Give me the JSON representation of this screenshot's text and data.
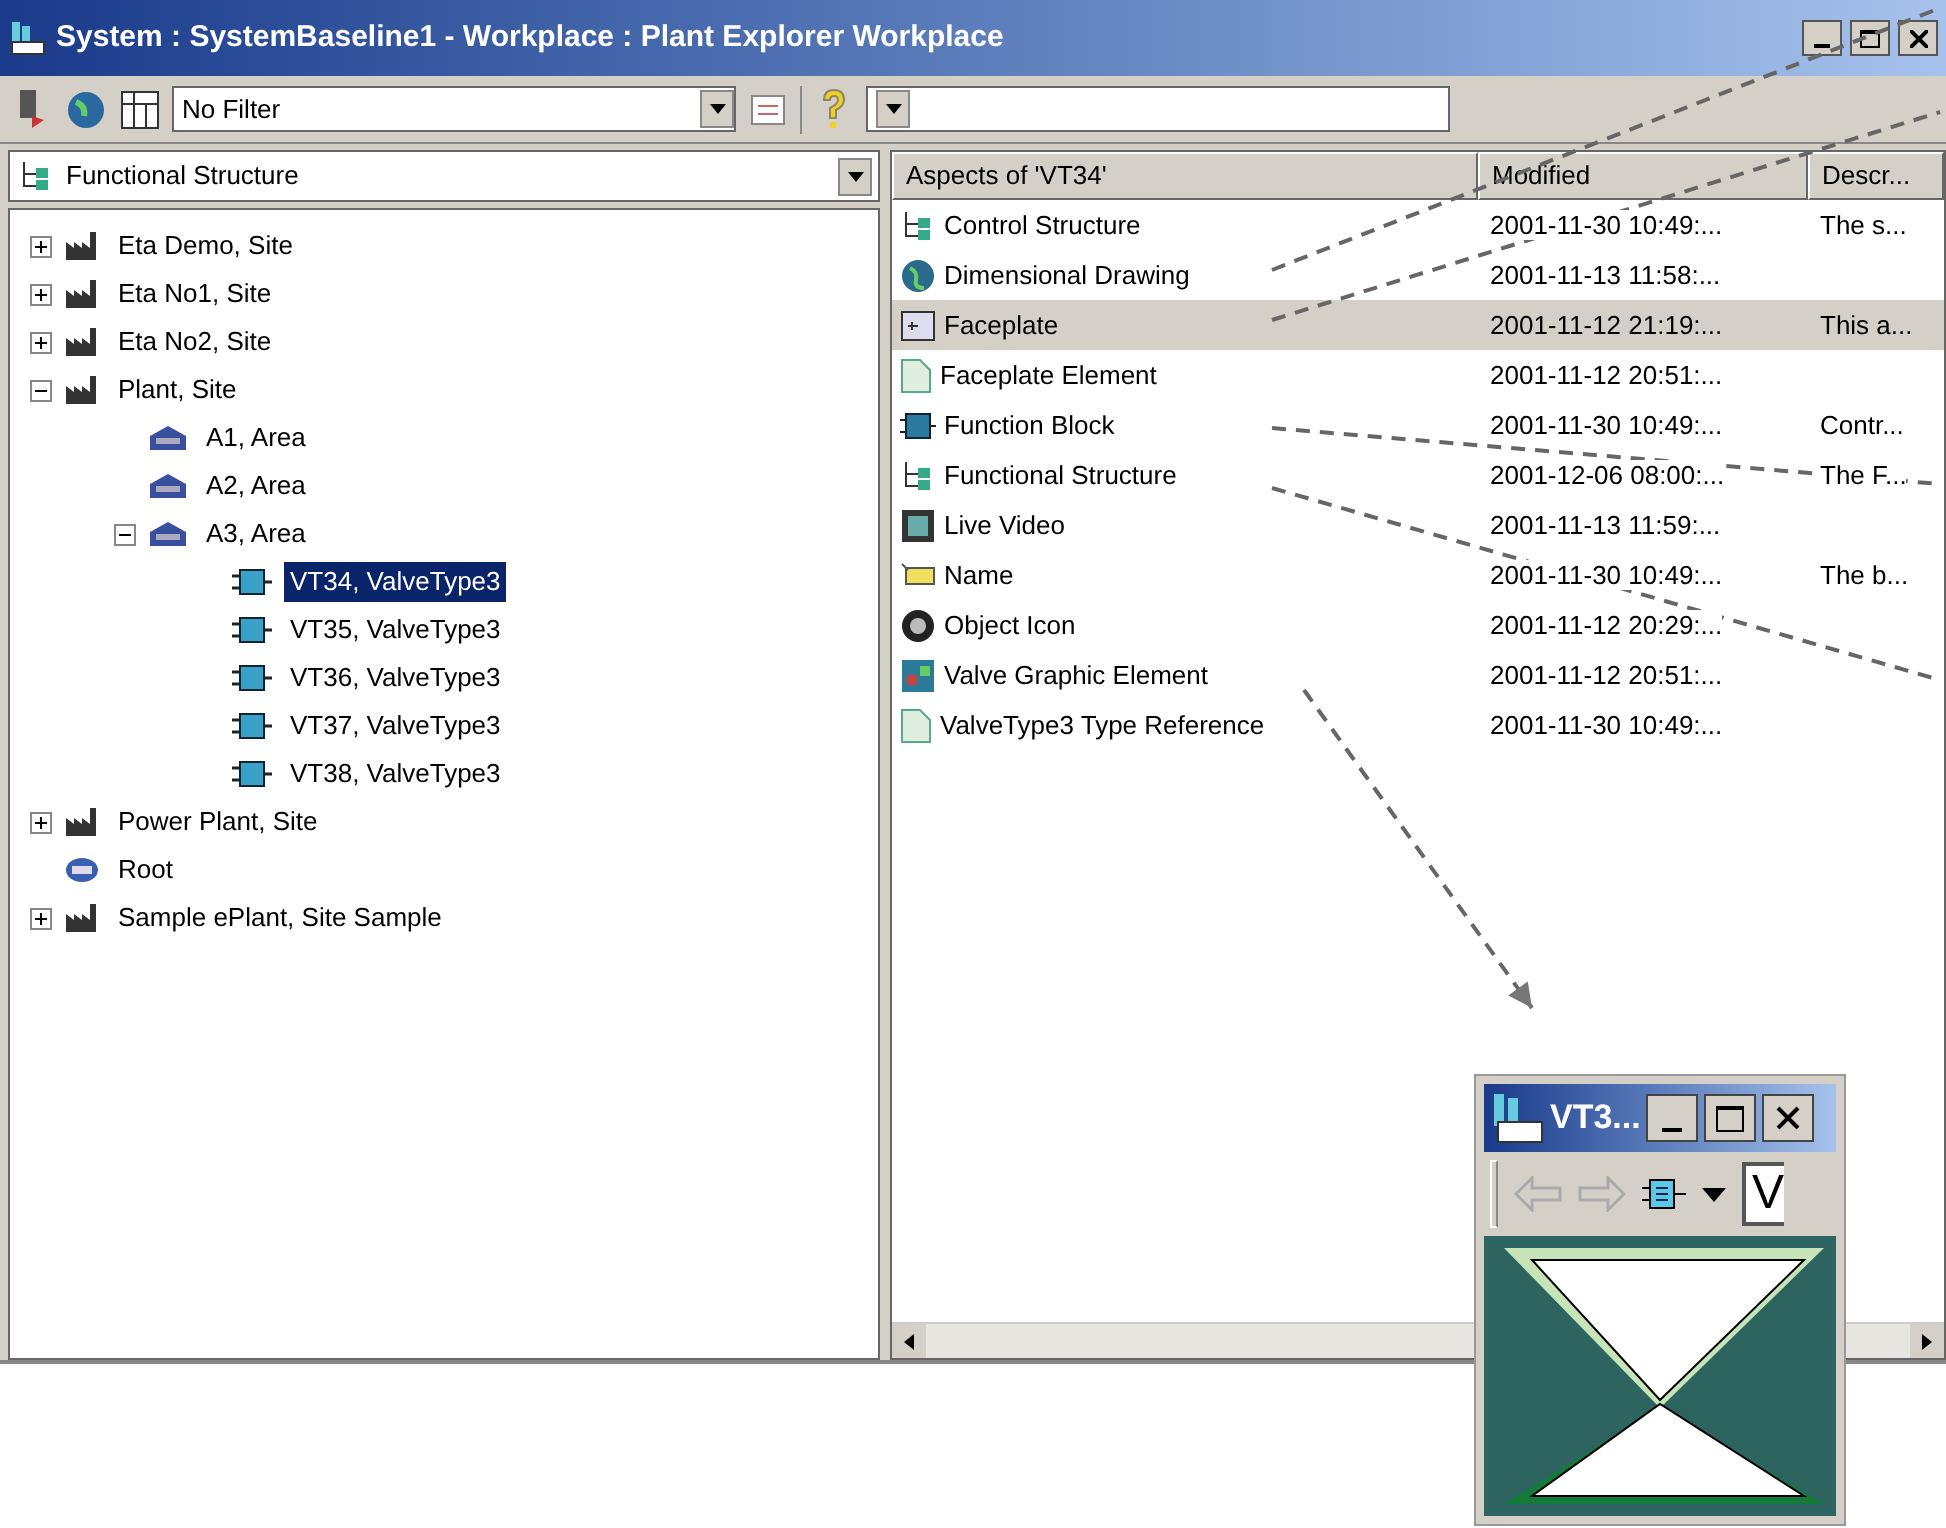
{
  "window": {
    "title": "System : SystemBaseline1 - Workplace : Plant Explorer Workplace"
  },
  "toolbar": {
    "filter": "No Filter"
  },
  "structure_selector": {
    "value": "Functional Structure"
  },
  "tree": [
    {
      "label": "Eta Demo, Site",
      "kind": "site",
      "expanded": false,
      "selected": false
    },
    {
      "label": "Eta No1, Site",
      "kind": "site",
      "expanded": false,
      "selected": false
    },
    {
      "label": "Eta No2, Site",
      "kind": "site",
      "expanded": false,
      "selected": false
    },
    {
      "label": "Plant, Site",
      "kind": "site",
      "expanded": true,
      "selected": false,
      "children": [
        {
          "label": "A1, Area",
          "kind": "area",
          "selected": false
        },
        {
          "label": "A2, Area",
          "kind": "area",
          "selected": false
        },
        {
          "label": "A3, Area",
          "kind": "area",
          "expanded": true,
          "selected": false,
          "children": [
            {
              "label": "VT34, ValveType3",
              "kind": "object",
              "selected": true
            },
            {
              "label": "VT35, ValveType3",
              "kind": "object",
              "selected": false
            },
            {
              "label": "VT36, ValveType3",
              "kind": "object",
              "selected": false
            },
            {
              "label": "VT37, ValveType3",
              "kind": "object",
              "selected": false
            },
            {
              "label": "VT38, ValveType3",
              "kind": "object",
              "selected": false
            }
          ]
        }
      ]
    },
    {
      "label": "Power Plant, Site",
      "kind": "site",
      "expanded": false,
      "selected": false
    },
    {
      "label": "Root",
      "kind": "root",
      "selected": false
    },
    {
      "label": "Sample ePlant, Site Sample",
      "kind": "site",
      "expanded": false,
      "selected": false
    }
  ],
  "aspects": {
    "columns": [
      "Aspects of 'VT34'",
      "Modified",
      "Descr..."
    ],
    "rows": [
      {
        "name": "Control Structure",
        "kind": "structure",
        "modified": "2001-11-30 10:49:...",
        "description": "The s...",
        "selected": false
      },
      {
        "name": "Dimensional Drawing",
        "kind": "globe",
        "modified": "2001-11-13 11:58:...",
        "selected": false
      },
      {
        "name": "Faceplate",
        "kind": "faceplate",
        "modified": "2001-11-12 21:19:...",
        "description": "This a...",
        "selected": true
      },
      {
        "name": "Faceplate Element",
        "kind": "document",
        "modified": "2001-11-12 20:51:...",
        "selected": false
      },
      {
        "name": "Function Block",
        "kind": "block",
        "modified": "2001-11-30 10:49:...",
        "description": "Contr...",
        "selected": false
      },
      {
        "name": "Functional Structure",
        "kind": "structure",
        "modified": "2001-12-06 08:00:...",
        "description": "The F...",
        "selected": false
      },
      {
        "name": "Live Video",
        "kind": "video",
        "modified": "2001-11-13 11:59:...",
        "selected": false
      },
      {
        "name": "Name",
        "kind": "tag",
        "modified": "2001-11-30 10:49:...",
        "description": "The b...",
        "selected": false
      },
      {
        "name": "Object Icon",
        "kind": "object",
        "modified": "2001-11-12 20:29:...",
        "selected": false
      },
      {
        "name": "Valve Graphic Element",
        "kind": "graphic",
        "modified": "2001-11-12 20:51:...",
        "selected": false
      },
      {
        "name": "ValveType3 Type Reference",
        "kind": "document",
        "modified": "2001-11-30 10:49:...",
        "selected": false
      }
    ]
  },
  "popup": {
    "title": "VT3...",
    "field": "V"
  }
}
